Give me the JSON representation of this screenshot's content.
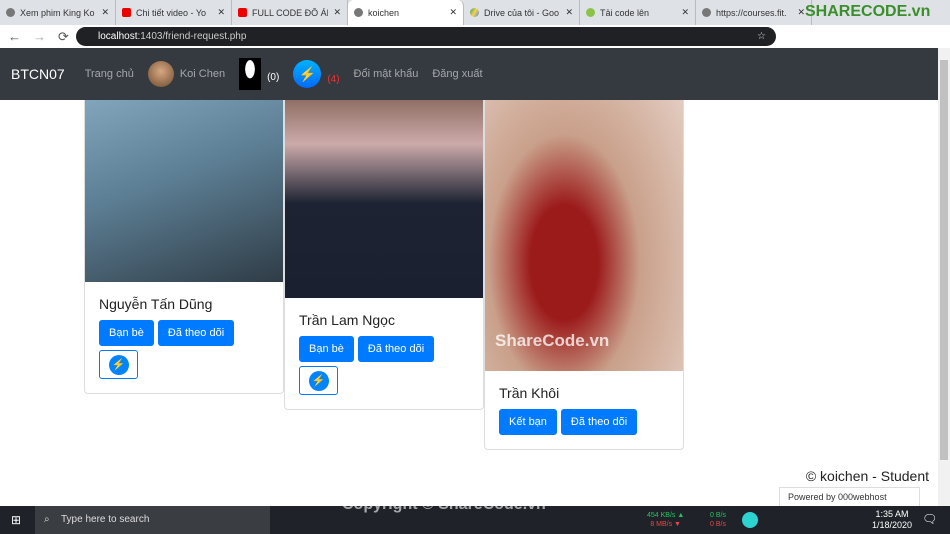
{
  "browser": {
    "tabs": [
      {
        "title": "Xem phim King Ko",
        "icon": "globe-icon"
      },
      {
        "title": "Chi tiết video - Yo",
        "icon": "youtube-icon"
      },
      {
        "title": "FULL CODE ĐỒ ÁN",
        "icon": "youtube-icon"
      },
      {
        "title": "koichen",
        "icon": "globe-icon",
        "active": true
      },
      {
        "title": "Drive của tôi - Goo",
        "icon": "drive-icon"
      },
      {
        "title": "Tải code lên",
        "icon": "sharecode-icon"
      },
      {
        "title": "https://courses.fit.",
        "icon": "globe-icon"
      }
    ],
    "url_host": "localhost",
    "url_path": ":1403/friend-request.php",
    "watermark": "SHARECODE.vn"
  },
  "navbar": {
    "brand": "BTCN07",
    "home": "Trang chủ",
    "user": "Koi Chen",
    "friend_count": "(0)",
    "message_count": "(4)",
    "change_password": "Đổi mật khẩu",
    "logout": "Đăng xuất"
  },
  "cards": [
    {
      "name": "Nguyễn Tấn Dũng",
      "buttons": [
        "Bạn bè",
        "Đã theo dõi"
      ],
      "messenger": true
    },
    {
      "name": "Trần Lam Ngọc",
      "buttons": [
        "Bạn bè",
        "Đã theo dõi"
      ],
      "messenger": true
    },
    {
      "name": "Trần Khôi",
      "buttons": [
        "Kết bạn",
        "Đã theo dõi"
      ],
      "messenger": false,
      "image_watermark": "ShareCode.vn"
    }
  ],
  "footer": {
    "text": "© koichen - Student",
    "powered": "Powered by 000webhost"
  },
  "taskbar": {
    "search_placeholder": "Type here to search",
    "net_up": "454 KB/s ▲",
    "net_down": "8 MB/s ▼",
    "net2_up": "0 B/s",
    "net2_down": "0 B/s",
    "time": "1:35 AM",
    "date": "1/18/2020",
    "watermark": "Copyright © ShareCode.vn",
    "colors": {
      "up": "#22c55e",
      "down": "#ef4444"
    }
  }
}
